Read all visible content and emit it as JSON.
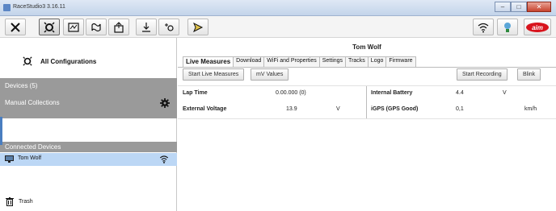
{
  "window": {
    "title": "RaceStudio3 3.16.11",
    "controls": [
      "minimize",
      "maximize",
      "close"
    ]
  },
  "toolbar": {
    "left_icons": [
      "tools-icon",
      "connect-icon",
      "analysis-icon",
      "track-icon",
      "export-icon",
      "download-icon",
      "settings-icon"
    ],
    "right_icons": [
      "wifi-icon",
      "thermometer-icon",
      "aim-logo"
    ],
    "brand": "AIM"
  },
  "sidebar": {
    "all_configurations": "All Configurations",
    "devices_header": "Devices (5)",
    "manual_collections": "Manual Collections",
    "connected_header": "Connected Devices",
    "connected_device": "Tom Wolf",
    "trash": "Trash"
  },
  "device": {
    "name": "Tom Wolf",
    "tabs": [
      "Live Measures",
      "Download",
      "WiFi and Properties",
      "Settings",
      "Tracks",
      "Logo",
      "Firmware"
    ],
    "active_tab": "Live Measures",
    "buttons": {
      "start_live": "Start Live Measures",
      "mv_values": "mV Values",
      "start_recording": "Start Recording",
      "blink": "Blink"
    },
    "measures": [
      {
        "label": "Lap Time",
        "value": "0.00.000 (0)",
        "unit": ""
      },
      {
        "label": "External Voltage",
        "value": "13.9",
        "unit": "V"
      }
    ],
    "measures_right": [
      {
        "label": "Internal Battery",
        "value": "4.4",
        "unit": "V"
      },
      {
        "label": "iGPS (GPS Good)",
        "value": "0,1",
        "unit": "km/h"
      }
    ]
  },
  "colors": {
    "sidebar_group_bg": "#9a9a9a",
    "selected_row_bg": "#bcd7f5",
    "aim_red": "#d8141d"
  }
}
